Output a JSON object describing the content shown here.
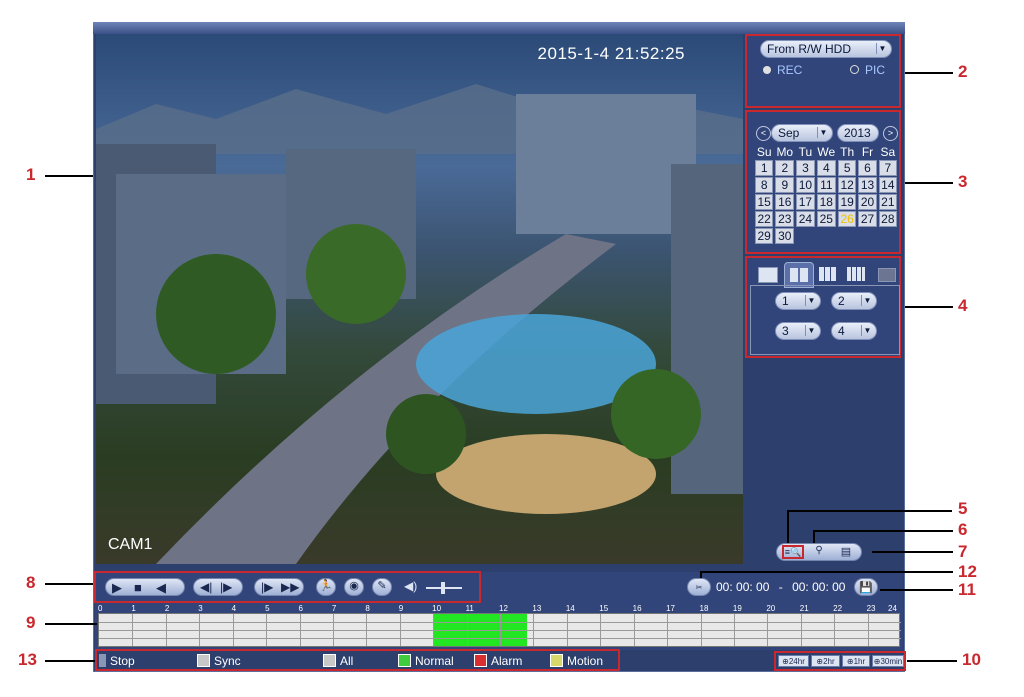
{
  "video": {
    "timestamp": "2015-1-4   21:52:25",
    "camera": "CAM1"
  },
  "source_panel": {
    "source_select": "From R/W HDD",
    "rec_label": "REC",
    "pic_label": "PIC"
  },
  "calendar": {
    "month": "Sep",
    "year": "2013",
    "weekdays": [
      "Su",
      "Mo",
      "Tu",
      "We",
      "Th",
      "Fr",
      "Sa"
    ],
    "weeks": [
      [
        "1",
        "2",
        "3",
        "4",
        "5",
        "6",
        "7"
      ],
      [
        "8",
        "9",
        "10",
        "11",
        "12",
        "13",
        "14"
      ],
      [
        "15",
        "16",
        "17",
        "18",
        "19",
        "20",
        "21"
      ],
      [
        "22",
        "23",
        "24",
        "25",
        "26",
        "27",
        "28"
      ],
      [
        "29",
        "30",
        "",
        "",
        "",
        "",
        ""
      ]
    ],
    "highlighted_day": "26"
  },
  "channel_panel": {
    "ch1": "1",
    "ch2": "2",
    "ch3": "3",
    "ch4": "4"
  },
  "playback": {
    "time_start": "00: 00: 00",
    "time_sep": "-",
    "time_end": "00: 00: 00"
  },
  "timeline": {
    "hours": [
      "0",
      "1",
      "2",
      "3",
      "4",
      "5",
      "6",
      "7",
      "8",
      "9",
      "10",
      "11",
      "12",
      "13",
      "14",
      "15",
      "16",
      "17",
      "18",
      "19",
      "20",
      "21",
      "22",
      "23",
      "24"
    ],
    "record_start_hour": 10,
    "record_end_hour": 12.8,
    "record_color": "#22e622"
  },
  "legend": {
    "stop": "Stop",
    "sync": "Sync",
    "all": "All",
    "normal": "Normal",
    "alarm": "Alarm",
    "motion": "Motion"
  },
  "zoom": {
    "z24": "24hr",
    "z2": "2hr",
    "z1": "1hr",
    "z30": "30min"
  },
  "callouts": {
    "c1": "1",
    "c2": "2",
    "c3": "3",
    "c4": "4",
    "c5": "5",
    "c6": "6",
    "c7": "7",
    "c8": "8",
    "c9": "9",
    "c10": "10",
    "c11": "11",
    "c12": "12",
    "c13": "13"
  },
  "colors": {
    "callout_red": "#c8282e",
    "panel_blue": "#31457a",
    "normal_green": "#3fcc3f",
    "alarm_red": "#d83030",
    "motion_yellow": "#d8d86a"
  }
}
